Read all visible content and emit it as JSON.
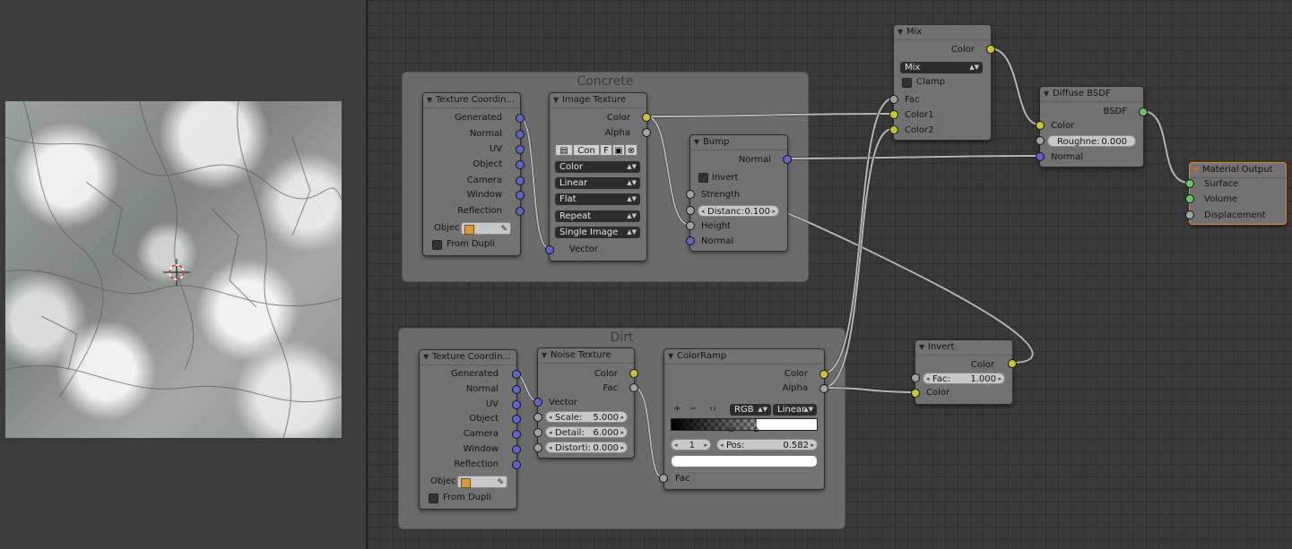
{
  "colors": {
    "socket_vector": "#6363c7",
    "socket_color": "#c7c729",
    "socket_float": "#a1a1a1",
    "socket_shader": "#63c763",
    "selected_outline": "#e08a2a"
  },
  "frames": {
    "concrete": "Concrete",
    "dirt": "Dirt"
  },
  "tex_coord_1": {
    "title": "Texture Coordin...",
    "outputs": [
      "Generated",
      "Normal",
      "UV",
      "Object",
      "Camera",
      "Window",
      "Reflection"
    ],
    "object_label": "Objec",
    "from_dupli": "From Dupli"
  },
  "image_texture": {
    "title": "Image Texture",
    "out_color": "Color",
    "out_alpha": "Alpha",
    "image_name": "Con",
    "fake_user": "F",
    "color_space": "Color",
    "interpolation": "Linear",
    "projection": "Flat",
    "extension": "Repeat",
    "source": "Single Image",
    "in_vector": "Vector"
  },
  "bump": {
    "title": "Bump",
    "out_normal": "Normal",
    "invert": "Invert",
    "strength": "Strength",
    "distance_label": "Distanc:",
    "distance_value": "0.100",
    "height": "Height",
    "normal": "Normal"
  },
  "mix": {
    "title": "Mix",
    "out_color": "Color",
    "blend_mode": "Mix",
    "clamp": "Clamp",
    "fac": "Fac",
    "color1": "Color1",
    "color2": "Color2"
  },
  "diffuse": {
    "title": "Diffuse BSDF",
    "out_bsdf": "BSDF",
    "color": "Color",
    "roughness_label": "Roughne:",
    "roughness_value": "0.000",
    "normal": "Normal"
  },
  "material_output": {
    "title": "Material Output",
    "surface": "Surface",
    "volume": "Volume",
    "displacement": "Displacement"
  },
  "tex_coord_2": {
    "title": "Texture Coordin...",
    "outputs": [
      "Generated",
      "Normal",
      "UV",
      "Object",
      "Camera",
      "Window",
      "Reflection"
    ],
    "object_label": "Objec",
    "from_dupli": "From Dupli"
  },
  "noise_texture": {
    "title": "Noise Texture",
    "out_color": "Color",
    "out_fac": "Fac",
    "vector": "Vector",
    "scale_label": "Scale:",
    "scale_value": "5.000",
    "detail_label": "Detail:",
    "detail_value": "6.000",
    "distortion_label": "Distorti:",
    "distortion_value": "0.000"
  },
  "colorramp": {
    "title": "ColorRamp",
    "out_color": "Color",
    "out_alpha": "Alpha",
    "add": "+",
    "remove": "−",
    "flip": "‹›",
    "color_mode": "RGB",
    "interpolation": "Linear",
    "active_stop": "1",
    "pos_label": "Pos:",
    "pos_value": "0.582",
    "stop_positions": [
      0.41,
      0.582
    ],
    "in_fac": "Fac"
  },
  "invert": {
    "title": "Invert",
    "out_color": "Color",
    "fac_label": "Fac:",
    "fac_value": "1.000",
    "color": "Color"
  }
}
